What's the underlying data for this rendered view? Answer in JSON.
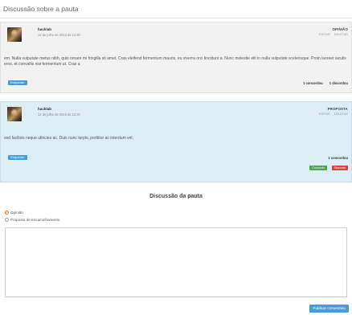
{
  "page_title": "Discussão sobre a pauta",
  "comments": [
    {
      "author": "hacklab",
      "date": "12 de julho de 2013 às 12:20",
      "type": "OPINIÃO",
      "actions": [
        "EDITAR",
        "DELETAR"
      ],
      "body": "em. Nulla vulputate metus nibh, quis ornare mi fringilla sit amet. Cras eleifend fermentum mauris, eu viverra orci tincidunt a. Nunc molestie elit in nulla vulputate scelerisque. Proin laoreet iaculis eros, et convallis nisi fermentum ut. Cras a",
      "reply_label": "Responder",
      "agree_count": "1 concordou",
      "disagree_count": "1 discordou"
    },
    {
      "author": "hacklab",
      "date": "12 de julho de 2013 às 12:20",
      "type": "PROPOSTA",
      "actions": [
        "EDITAR",
        "DELETAR"
      ],
      "body": "sed facilisis neque ultricies ac. Duis nunc turpis, porttitor ac interdum vel,",
      "reply_label": "Responder",
      "agree_count": "1 concordou",
      "agree_label": "Concordo",
      "disagree_label": "Discordo"
    }
  ],
  "discussion": {
    "title": "Discussão da pauta",
    "options": [
      "Opinião",
      "Proposta de encaminhamento"
    ],
    "selected": "Opinião",
    "submit_label": "Publicar comentário"
  },
  "colors": {
    "accent_blue": "#3fa0d8",
    "agree_green": "#4aa84a",
    "disagree_red": "#d9433c",
    "radio_orange": "#e0701c"
  }
}
